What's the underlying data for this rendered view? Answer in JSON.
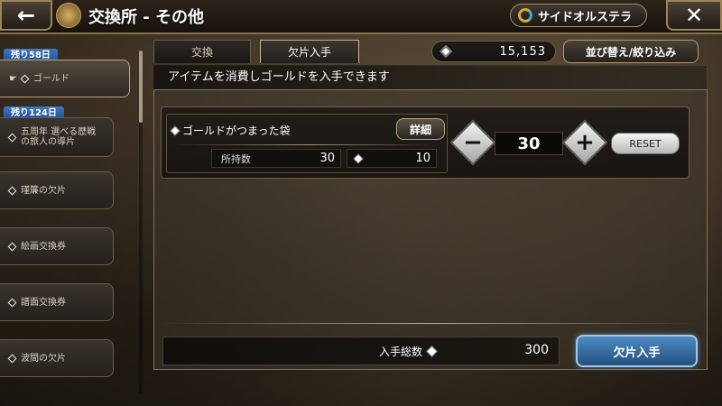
{
  "header": {
    "title": "交換所 - その他",
    "world_button": "サイドオルステラ",
    "back_icon": "back-arrow-icon",
    "close_icon": "close-icon"
  },
  "tabs": [
    {
      "label": "交換",
      "active": false
    },
    {
      "label": "欠片入手",
      "active": true
    }
  ],
  "currency": {
    "value": "15,153"
  },
  "sort_button": "並び替え/絞り込み",
  "panel_description": "アイテムを消費しゴールドを入手できます",
  "sidebar": {
    "items": [
      {
        "ribbon": "残り58日",
        "label": "ゴールド",
        "active": true
      },
      {
        "ribbon": "残り124日",
        "label": "五周年 選べる歴戦の旅人の導片",
        "active": false
      },
      {
        "ribbon": "",
        "label": "瑾簾の欠片",
        "active": false
      },
      {
        "ribbon": "",
        "label": "絵画交換券",
        "active": false
      },
      {
        "ribbon": "",
        "label": "譜面交換券",
        "active": false
      },
      {
        "ribbon": "",
        "label": "波間の欠片",
        "active": false
      }
    ]
  },
  "item": {
    "name": "ゴールドがつまった袋",
    "detail_button": "詳細",
    "owned_label": "所持数",
    "owned_value": "30",
    "cost_value": "10",
    "quantity": "30",
    "reset_button": "RESET"
  },
  "footer": {
    "total_label": "入手総数",
    "total_value": "300",
    "acquire_button": "欠片入手"
  }
}
